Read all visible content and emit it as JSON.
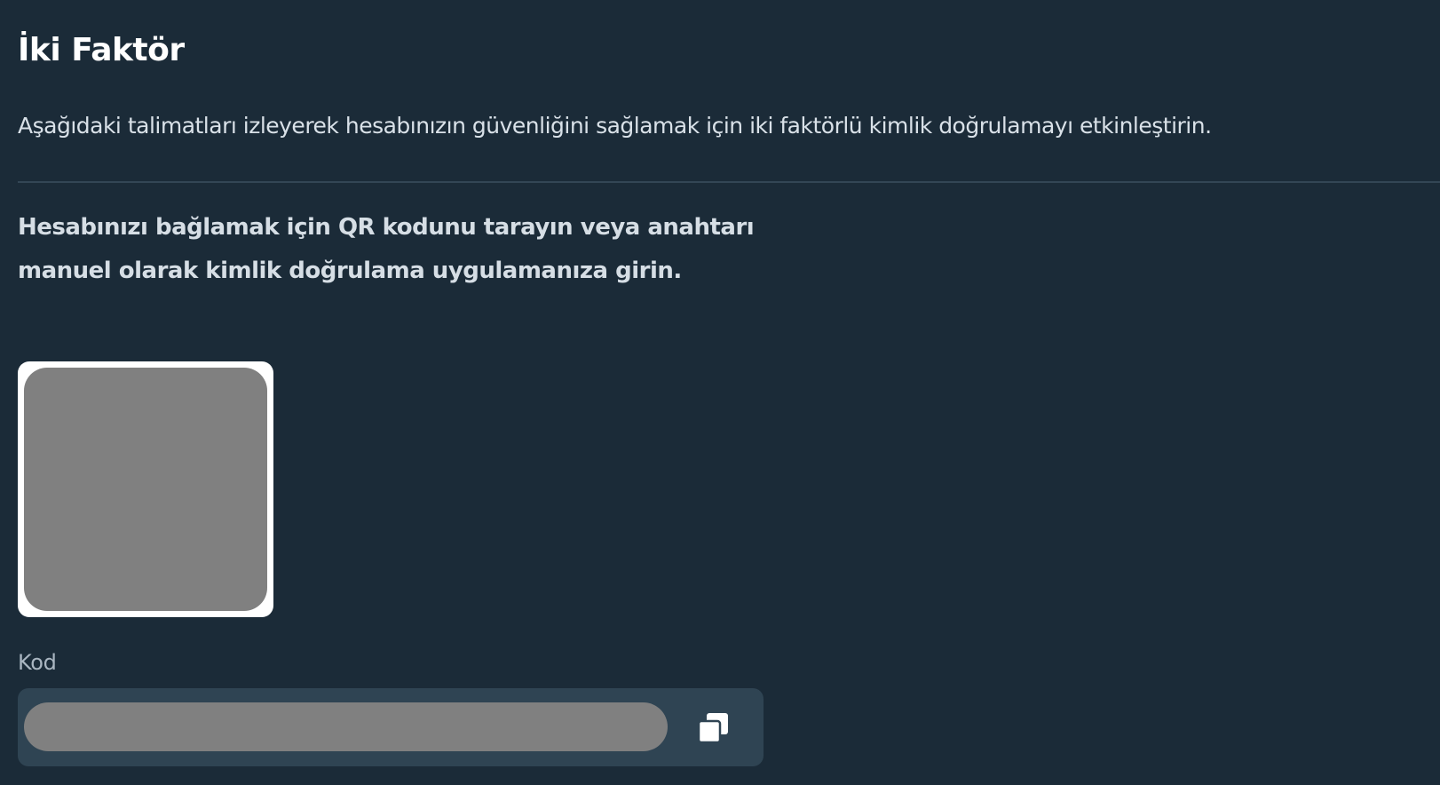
{
  "page": {
    "title": "İki Faktör",
    "description": "Aşağıdaki talimatları izleyerek hesabınızın güvenliğini sağlamak için iki faktörlü kimlik doğrulamayı etkinleştirin."
  },
  "setup": {
    "instructions": "Hesabınızı bağlamak için QR kodunu tarayın veya anahtarı manuel olarak kimlik doğrulama uygulamanıza girin.",
    "code_label": "Kod",
    "code_value": ""
  },
  "icons": {
    "copy": "copy-icon"
  },
  "colors": {
    "background": "#1b2b38",
    "code_box": "#2f4453",
    "placeholder": "#808080"
  }
}
